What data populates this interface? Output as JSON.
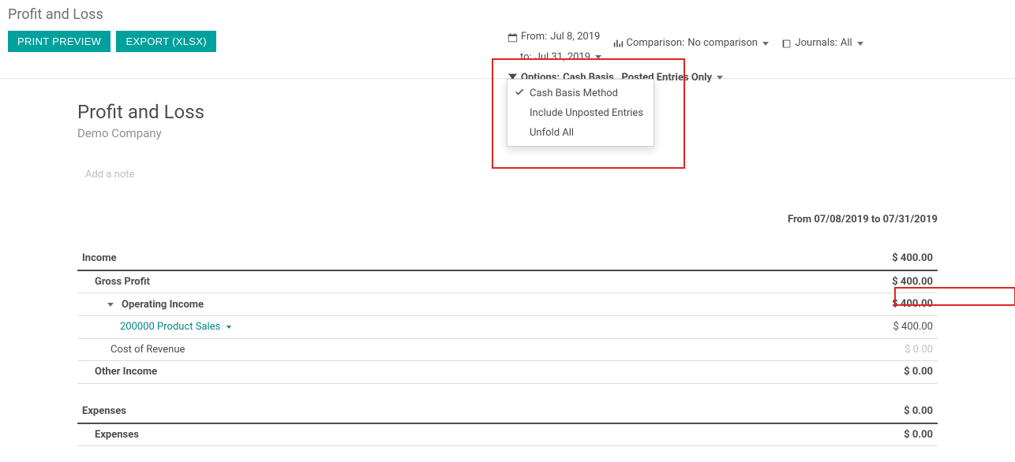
{
  "header": {
    "title": "Profit and Loss",
    "print_label": "PRINT PREVIEW",
    "export_label": "EXPORT (XLSX)"
  },
  "filters": {
    "from_label": "From:",
    "from_value": "Jul 8, 2019",
    "to_label": "to:",
    "to_value": "Jul 31, 2019",
    "comparison_label": "Comparison:",
    "comparison_value": "No comparison",
    "journals_label": "Journals:",
    "journals_value": "All",
    "options_label": "Options:",
    "options_value": "Cash Basis , Posted Entries Only"
  },
  "dropdown": {
    "item1": "Cash Basis Method",
    "item2": "Include Unposted Entries",
    "item3": "Unfold All"
  },
  "report": {
    "title": "Profit and Loss",
    "company": "Demo Company",
    "add_note": "Add a note",
    "date_range": "From 07/08/2019 to 07/31/2019",
    "rows": {
      "income": {
        "label": "Income",
        "val": "$ 400.00"
      },
      "gross_profit": {
        "label": "Gross Profit",
        "val": "$ 400.00"
      },
      "operating_income": {
        "label": "Operating Income",
        "val": "$ 400.00"
      },
      "product_sales": {
        "label": "200000 Product Sales",
        "val": "$ 400.00"
      },
      "cost_of_revenue": {
        "label": "Cost of Revenue",
        "val": "$ 0.00"
      },
      "other_income": {
        "label": "Other Income",
        "val": "$ 0.00"
      },
      "expenses1": {
        "label": "Expenses",
        "val": "$ 0.00"
      },
      "expenses2": {
        "label": "Expenses",
        "val": "$ 0.00"
      }
    }
  }
}
